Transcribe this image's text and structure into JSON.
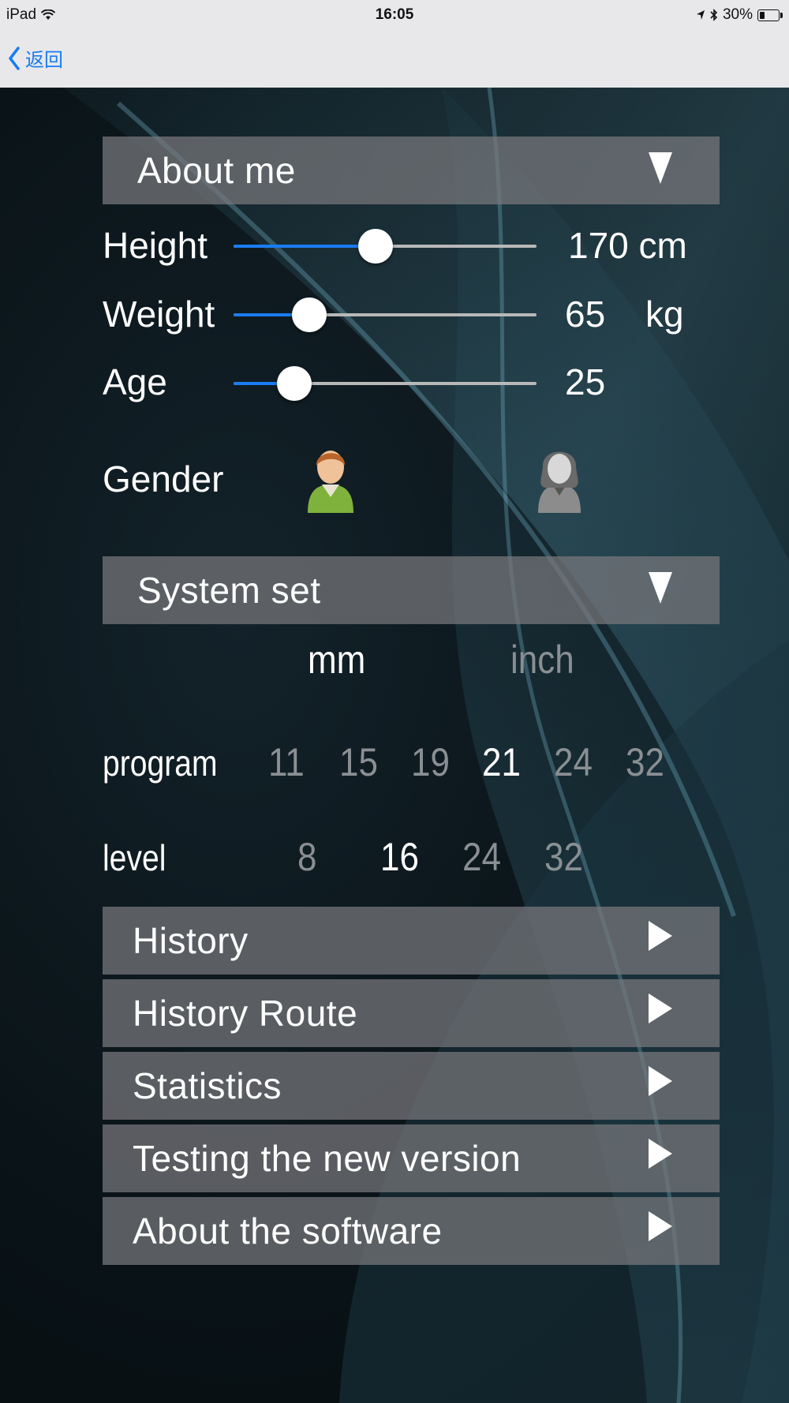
{
  "status_bar": {
    "device": "iPad",
    "time": "16:05",
    "battery": "30%",
    "battery_level": 0.3
  },
  "nav": {
    "back_label": "返回"
  },
  "about_me": {
    "title": "About me",
    "height": {
      "label": "Height",
      "value": "170 cm",
      "level": 0.47
    },
    "weight": {
      "label": "Weight",
      "value": "65",
      "unit": "kg",
      "level": 0.25
    },
    "age": {
      "label": "Age",
      "value": "25",
      "level": 0.2
    },
    "gender": {
      "label": "Gender",
      "selected": "male"
    }
  },
  "system_set": {
    "title": "System set",
    "units": [
      {
        "label": "mm",
        "selected": true
      },
      {
        "label": "inch",
        "selected": false
      }
    ],
    "program": {
      "label": "program",
      "options": [
        "11",
        "15",
        "19",
        "21",
        "24",
        "32"
      ],
      "selected": "21"
    },
    "level": {
      "label": "level",
      "options": [
        "8",
        "16",
        "24",
        "32"
      ],
      "selected": "16"
    }
  },
  "menu": [
    {
      "label": "History"
    },
    {
      "label": "History Route"
    },
    {
      "label": "Statistics"
    },
    {
      "label": "Testing the new version"
    },
    {
      "label": "About the software"
    }
  ],
  "colors": {
    "accent": "#1a7cf2",
    "panel": "#78787d"
  }
}
